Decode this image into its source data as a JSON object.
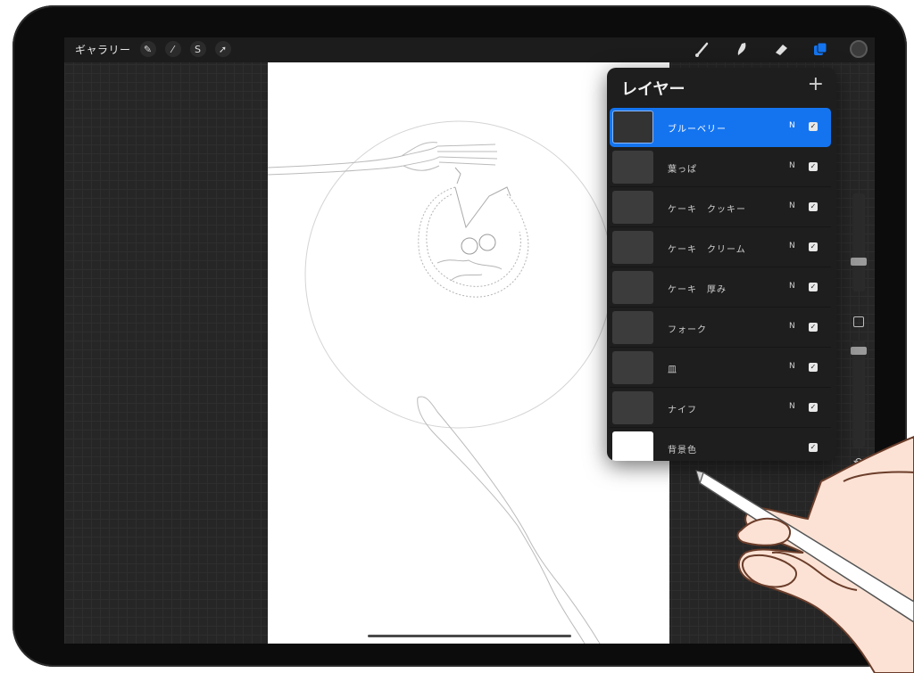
{
  "toolbar": {
    "gallery_label": "ギャラリー",
    "left_icons": [
      {
        "name": "wrench-icon",
        "glyph": "✎"
      },
      {
        "name": "magic-wand-icon",
        "glyph": "⁄"
      },
      {
        "name": "selection-icon",
        "glyph": "S"
      },
      {
        "name": "transform-icon",
        "glyph": "➚"
      }
    ],
    "right_tools": [
      "brush-icon",
      "smudge-icon",
      "eraser-icon",
      "layers-icon"
    ],
    "active_tool_color": "#1474f0",
    "color_swatch": "#3b3b3b"
  },
  "layers_panel": {
    "title": "レイヤー",
    "add_symbol": "+",
    "layers": [
      {
        "name": "ブルーベリー",
        "mode": "N",
        "visible": true,
        "active": true,
        "thumb": "dark"
      },
      {
        "name": "葉っぱ",
        "mode": "N",
        "visible": true,
        "active": false,
        "thumb": "dark"
      },
      {
        "name": "ケーキ　クッキー",
        "mode": "N",
        "visible": true,
        "active": false,
        "thumb": "dark"
      },
      {
        "name": "ケーキ　クリーム",
        "mode": "N",
        "visible": true,
        "active": false,
        "thumb": "dark"
      },
      {
        "name": "ケーキ　厚み",
        "mode": "N",
        "visible": true,
        "active": false,
        "thumb": "dark"
      },
      {
        "name": "フォーク",
        "mode": "N",
        "visible": true,
        "active": false,
        "thumb": "dark"
      },
      {
        "name": "皿",
        "mode": "N",
        "visible": true,
        "active": false,
        "thumb": "dark"
      },
      {
        "name": "ナイフ",
        "mode": "N",
        "visible": true,
        "active": false,
        "thumb": "dark"
      },
      {
        "name": "背景色",
        "mode": "",
        "visible": true,
        "active": false,
        "thumb": "white"
      }
    ]
  },
  "sidebar": {
    "undo_glyph": "↶"
  },
  "colors": {
    "accent": "#1474f0",
    "panel": "#1e1e1e",
    "device": "#0c0c0c"
  }
}
